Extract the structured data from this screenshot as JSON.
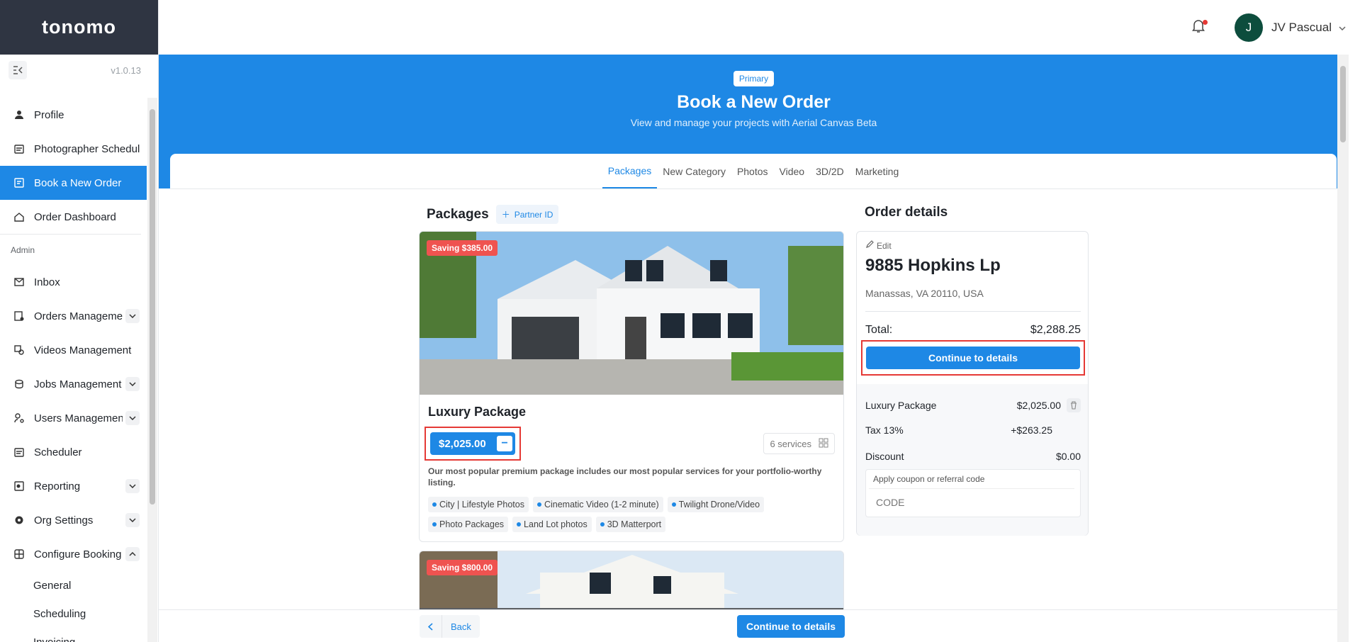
{
  "app": {
    "logo": "tonomo",
    "version": "v1.0.13"
  },
  "sidebar": {
    "items": [
      {
        "label": "Profile"
      },
      {
        "label": "Photographer Schedule"
      },
      {
        "label": "Book a New Order"
      },
      {
        "label": "Order Dashboard"
      }
    ],
    "admin_label": "Admin",
    "admin_items": [
      {
        "label": "Inbox"
      },
      {
        "label": "Orders Management"
      },
      {
        "label": "Videos Management"
      },
      {
        "label": "Jobs Management"
      },
      {
        "label": "Users Management"
      },
      {
        "label": "Scheduler"
      },
      {
        "label": "Reporting"
      },
      {
        "label": "Org Settings"
      },
      {
        "label": "Configure Booking"
      }
    ],
    "sub_items": [
      {
        "label": "General"
      },
      {
        "label": "Scheduling"
      },
      {
        "label": "Invoicing"
      }
    ]
  },
  "header": {
    "user_initial": "J",
    "user_name": "JV Pascual"
  },
  "hero": {
    "badge": "Primary",
    "title": "Book a New Order",
    "subtitle": "View and manage your projects with Aerial Canvas Beta"
  },
  "tabs": [
    {
      "label": "Packages"
    },
    {
      "label": "New Category"
    },
    {
      "label": "Photos"
    },
    {
      "label": "Video"
    },
    {
      "label": "3D/2D"
    },
    {
      "label": "Marketing"
    }
  ],
  "packages": {
    "title": "Packages",
    "partner_btn": "Partner ID",
    "cards": [
      {
        "saving": "Saving $385.00",
        "title": "Luxury Package",
        "price": "$2,025.00",
        "services": "6 services",
        "description": "Our most popular premium package includes our most popular services for your portfolio-worthy listing.",
        "chips": [
          "City | Lifestyle Photos",
          "Cinematic Video (1-2 minute)",
          "Twilight Drone/Video",
          "Photo Packages",
          "Land Lot photos",
          "3D Matterport"
        ]
      },
      {
        "saving": "Saving $800.00"
      }
    ]
  },
  "order": {
    "title": "Order details",
    "edit": "Edit",
    "address": "9885 Hopkins Lp",
    "city": "Manassas, VA 20110, USA",
    "total_label": "Total:",
    "total_value": "$2,288.25",
    "continue": "Continue to details",
    "line_item_label": "Luxury Package",
    "line_item_value": "$2,025.00",
    "tax_label": "Tax 13%",
    "tax_value": "+$263.25",
    "discount_label": "Discount",
    "discount_value": "$0.00",
    "coupon_label": "Apply coupon or referral code",
    "coupon_placeholder": "CODE"
  },
  "footer": {
    "back": "Back",
    "continue": "Continue to details"
  },
  "colors": {
    "primary": "#1e88e5",
    "sidebar_dark": "#2f3542",
    "highlight": "#e53935",
    "saving": "#ef5350"
  }
}
